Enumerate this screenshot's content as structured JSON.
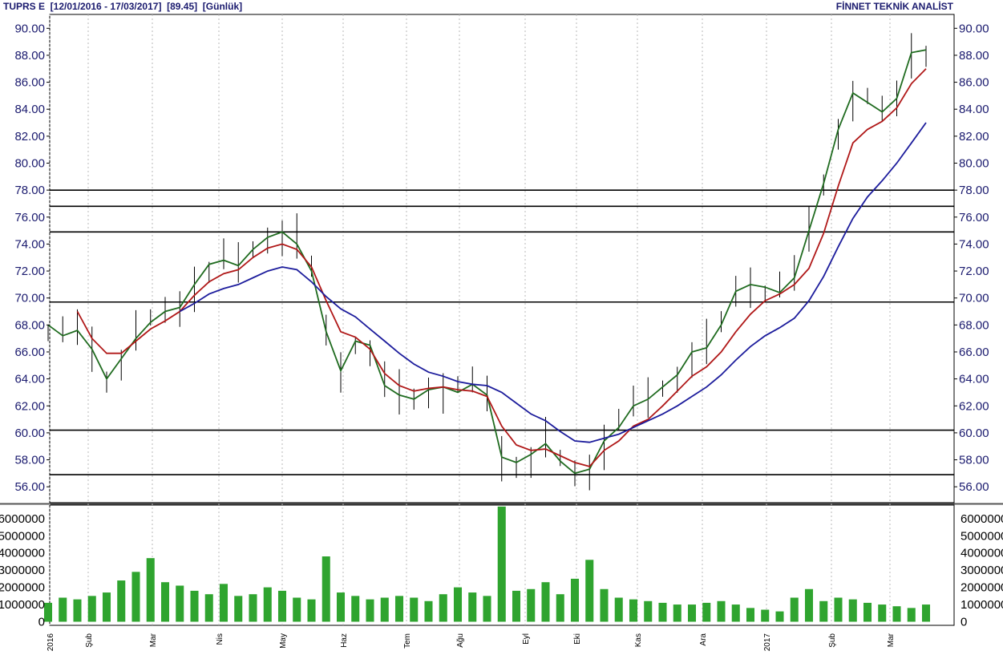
{
  "header": {
    "left": "TUPRS E  [12/01/2016 - 17/03/2017]  [89.45]  [Günlük]",
    "right": "FİNNET TEKNİK ANALİST"
  },
  "colors": {
    "ma_short": "#1f6b1f",
    "ma_mid": "#b01818",
    "ma_long": "#1c1c9c",
    "volume": "#2fa42f",
    "candle": "#000000",
    "text": "#1a1a6e"
  },
  "chart_data": [
    {
      "type": "line",
      "panel": "price",
      "y_ticks": [
        "90.00",
        "88.00",
        "86.00",
        "84.00",
        "82.00",
        "80.00",
        "78.00",
        "76.00",
        "74.00",
        "72.00",
        "70.00",
        "68.00",
        "66.00",
        "64.00",
        "62.00",
        "60.00",
        "58.00",
        "56.00"
      ],
      "ylim": [
        55,
        90.6
      ],
      "x_ticks": [
        "2016",
        "Şub",
        "Mar",
        "Nis",
        "May",
        "Haz",
        "Tem",
        "Ağu",
        "Eyl",
        "Eki",
        "Kas",
        "Ara",
        "2017",
        "Şub",
        "Mar"
      ],
      "horizontal_levels": [
        78.0,
        76.8,
        74.9,
        69.7,
        60.2,
        56.9
      ],
      "series": [
        {
          "role": "ma_short",
          "points": [
            [
              0,
              68.0
            ],
            [
              1,
              67.2
            ],
            [
              2,
              67.6
            ],
            [
              3,
              66.2
            ],
            [
              4,
              64.0
            ],
            [
              5,
              65.5
            ],
            [
              6,
              67.0
            ],
            [
              7,
              68.2
            ],
            [
              8,
              69.0
            ],
            [
              9,
              69.3
            ],
            [
              10,
              71.0
            ],
            [
              11,
              72.5
            ],
            [
              12,
              72.8
            ],
            [
              13,
              72.4
            ],
            [
              14,
              73.6
            ],
            [
              15,
              74.5
            ],
            [
              16,
              74.9
            ],
            [
              17,
              74.0
            ],
            [
              18,
              72.0
            ],
            [
              19,
              67.5
            ],
            [
              20,
              64.6
            ],
            [
              21,
              66.8
            ],
            [
              22,
              66.5
            ],
            [
              23,
              63.5
            ],
            [
              24,
              62.8
            ],
            [
              25,
              62.5
            ],
            [
              26,
              63.2
            ],
            [
              27,
              63.4
            ],
            [
              28,
              63.0
            ],
            [
              29,
              63.6
            ],
            [
              30,
              62.8
            ],
            [
              31,
              58.2
            ],
            [
              32,
              57.8
            ],
            [
              33,
              58.4
            ],
            [
              34,
              59.2
            ],
            [
              35,
              57.9
            ],
            [
              36,
              57.0
            ],
            [
              37,
              57.3
            ],
            [
              38,
              59.4
            ],
            [
              39,
              60.4
            ],
            [
              40,
              62.0
            ],
            [
              41,
              62.5
            ],
            [
              42,
              63.4
            ],
            [
              43,
              64.3
            ],
            [
              44,
              66.0
            ],
            [
              45,
              66.3
            ],
            [
              46,
              68.0
            ],
            [
              47,
              70.5
            ],
            [
              48,
              71.0
            ],
            [
              49,
              70.8
            ],
            [
              50,
              70.4
            ],
            [
              51,
              71.5
            ],
            [
              52,
              75.0
            ],
            [
              53,
              78.5
            ],
            [
              54,
              82.5
            ],
            [
              55,
              85.2
            ],
            [
              56,
              84.5
            ],
            [
              57,
              83.8
            ],
            [
              58,
              84.8
            ],
            [
              59,
              88.2
            ],
            [
              60,
              88.4
            ]
          ]
        },
        {
          "role": "ma_mid",
          "points": [
            [
              2,
              69.0
            ],
            [
              3,
              67.0
            ],
            [
              4,
              65.9
            ],
            [
              5,
              65.9
            ],
            [
              6,
              66.8
            ],
            [
              7,
              67.7
            ],
            [
              8,
              68.3
            ],
            [
              9,
              69.0
            ],
            [
              10,
              70.2
            ],
            [
              11,
              71.2
            ],
            [
              12,
              71.8
            ],
            [
              13,
              72.1
            ],
            [
              14,
              73.0
            ],
            [
              15,
              73.7
            ],
            [
              16,
              74.0
            ],
            [
              17,
              73.6
            ],
            [
              18,
              72.3
            ],
            [
              19,
              69.8
            ],
            [
              20,
              67.5
            ],
            [
              21,
              67.1
            ],
            [
              22,
              66.2
            ],
            [
              23,
              64.4
            ],
            [
              24,
              63.5
            ],
            [
              25,
              63.1
            ],
            [
              26,
              63.3
            ],
            [
              27,
              63.4
            ],
            [
              28,
              63.2
            ],
            [
              29,
              63.1
            ],
            [
              30,
              62.7
            ],
            [
              31,
              60.5
            ],
            [
              32,
              59.1
            ],
            [
              33,
              58.7
            ],
            [
              34,
              58.8
            ],
            [
              35,
              58.3
            ],
            [
              36,
              57.8
            ],
            [
              37,
              57.5
            ],
            [
              38,
              58.7
            ],
            [
              39,
              59.4
            ],
            [
              40,
              60.5
            ],
            [
              41,
              61.0
            ],
            [
              42,
              62.0
            ],
            [
              43,
              63.1
            ],
            [
              44,
              64.2
            ],
            [
              45,
              64.9
            ],
            [
              46,
              66.0
            ],
            [
              47,
              67.5
            ],
            [
              48,
              68.8
            ],
            [
              49,
              69.8
            ],
            [
              50,
              70.3
            ],
            [
              51,
              71.0
            ],
            [
              52,
              72.2
            ],
            [
              53,
              74.8
            ],
            [
              54,
              78.3
            ],
            [
              55,
              81.5
            ],
            [
              56,
              82.5
            ],
            [
              57,
              83.1
            ],
            [
              58,
              84.1
            ],
            [
              59,
              85.9
            ],
            [
              60,
              87.0
            ]
          ]
        },
        {
          "role": "ma_long",
          "points": [
            [
              9,
              69.0
            ],
            [
              10,
              69.6
            ],
            [
              11,
              70.3
            ],
            [
              12,
              70.7
            ],
            [
              13,
              71.0
            ],
            [
              14,
              71.5
            ],
            [
              15,
              72.0
            ],
            [
              16,
              72.3
            ],
            [
              17,
              72.1
            ],
            [
              18,
              71.2
            ],
            [
              19,
              70.1
            ],
            [
              20,
              69.2
            ],
            [
              21,
              68.6
            ],
            [
              22,
              67.7
            ],
            [
              23,
              66.8
            ],
            [
              24,
              65.9
            ],
            [
              25,
              65.1
            ],
            [
              26,
              64.5
            ],
            [
              27,
              64.2
            ],
            [
              28,
              63.8
            ],
            [
              29,
              63.6
            ],
            [
              30,
              63.5
            ],
            [
              31,
              63.0
            ],
            [
              32,
              62.2
            ],
            [
              33,
              61.4
            ],
            [
              34,
              60.9
            ],
            [
              35,
              60.1
            ],
            [
              36,
              59.4
            ],
            [
              37,
              59.3
            ],
            [
              38,
              59.6
            ],
            [
              39,
              59.9
            ],
            [
              40,
              60.4
            ],
            [
              41,
              60.9
            ],
            [
              42,
              61.4
            ],
            [
              43,
              62.0
            ],
            [
              44,
              62.7
            ],
            [
              45,
              63.4
            ],
            [
              46,
              64.3
            ],
            [
              47,
              65.4
            ],
            [
              48,
              66.4
            ],
            [
              49,
              67.2
            ],
            [
              50,
              67.8
            ],
            [
              51,
              68.5
            ],
            [
              52,
              69.8
            ],
            [
              53,
              71.6
            ],
            [
              54,
              73.8
            ],
            [
              55,
              75.9
            ],
            [
              56,
              77.5
            ],
            [
              57,
              78.7
            ],
            [
              58,
              80.0
            ],
            [
              59,
              81.5
            ],
            [
              60,
              83.0
            ]
          ]
        }
      ]
    },
    {
      "type": "bar",
      "panel": "volume",
      "y_ticks": [
        "6000000",
        "5000000",
        "4000000",
        "3000000",
        "2000000",
        "1000000",
        "0"
      ],
      "ylim": [
        0,
        6600000
      ],
      "values": [
        1100000,
        1400000,
        1300000,
        1500000,
        1700000,
        2400000,
        2900000,
        3700000,
        2300000,
        2100000,
        1800000,
        1600000,
        2200000,
        1500000,
        1600000,
        2000000,
        1800000,
        1400000,
        1300000,
        3800000,
        1700000,
        1500000,
        1300000,
        1400000,
        1500000,
        1400000,
        1200000,
        1600000,
        2000000,
        1700000,
        1500000,
        6700000,
        1800000,
        1900000,
        2300000,
        1600000,
        2500000,
        3600000,
        1900000,
        1400000,
        1300000,
        1200000,
        1100000,
        1000000,
        1000000,
        1100000,
        1200000,
        1000000,
        800000,
        700000,
        600000,
        1400000,
        1900000,
        1200000,
        1400000,
        1300000,
        1100000,
        1000000,
        900000,
        800000,
        1000000
      ]
    }
  ]
}
